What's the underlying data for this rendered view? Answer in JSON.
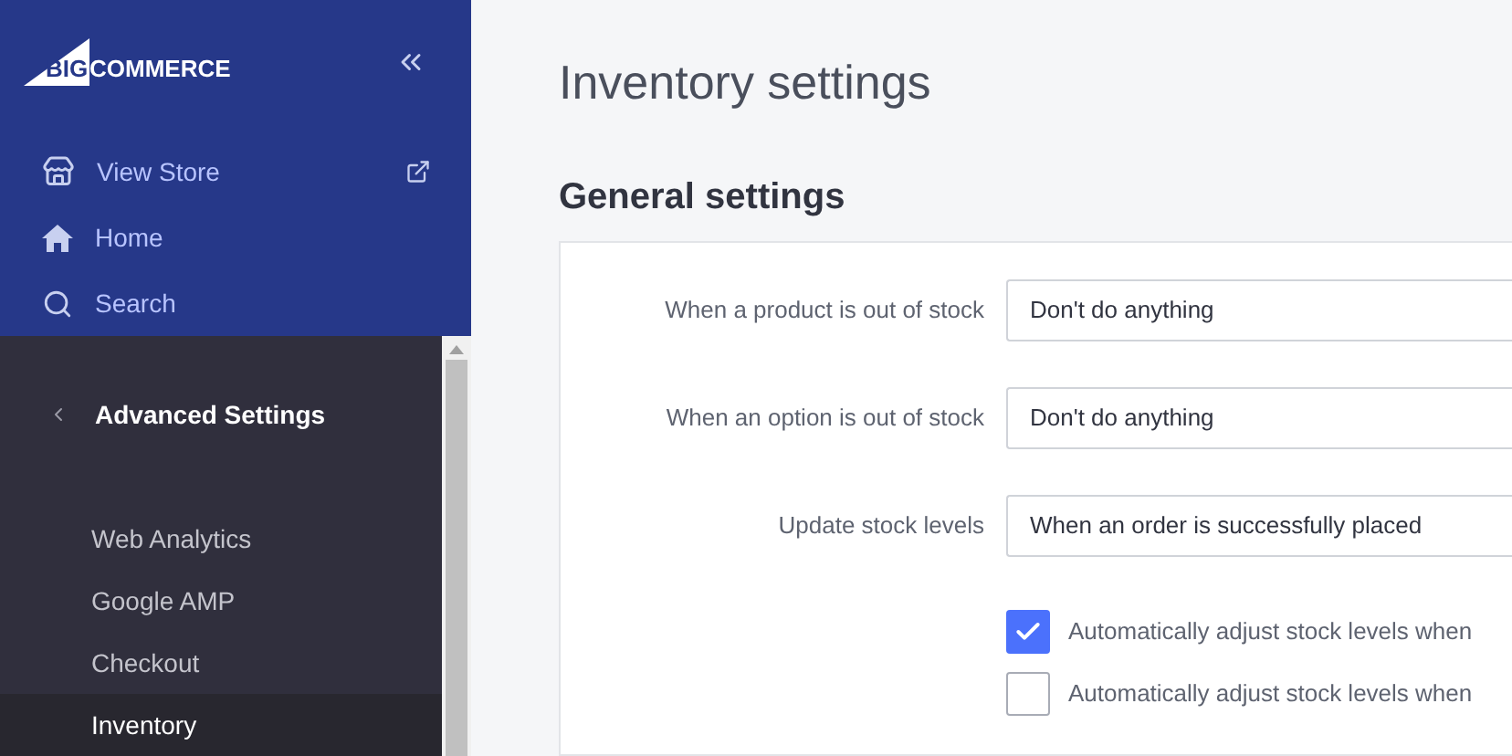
{
  "logo": {
    "mark": "BIG",
    "word": "COMMERCE"
  },
  "sidebar": {
    "top_items": [
      {
        "kind": "store",
        "label": "View Store",
        "external": true
      },
      {
        "kind": "home",
        "label": "Home",
        "external": false
      },
      {
        "kind": "search",
        "label": "Search",
        "external": false
      }
    ],
    "section": {
      "title": "Advanced Settings"
    },
    "items": [
      {
        "label": "Web Analytics",
        "selected": false
      },
      {
        "label": "Google AMP",
        "selected": false
      },
      {
        "label": "Checkout",
        "selected": false
      },
      {
        "label": "Inventory",
        "selected": true
      }
    ]
  },
  "page": {
    "title": "Inventory settings",
    "section_title": "General settings",
    "fields": [
      {
        "label": "When a product is out of stock",
        "value": "Don't do anything"
      },
      {
        "label": "When an option is out of stock",
        "value": "Don't do anything"
      },
      {
        "label": "Update stock levels",
        "value": "When an order is successfully placed"
      }
    ],
    "checkboxes": [
      {
        "label": "Automatically adjust stock levels when",
        "checked": true
      },
      {
        "label": "Automatically adjust stock levels when",
        "checked": false
      }
    ]
  }
}
